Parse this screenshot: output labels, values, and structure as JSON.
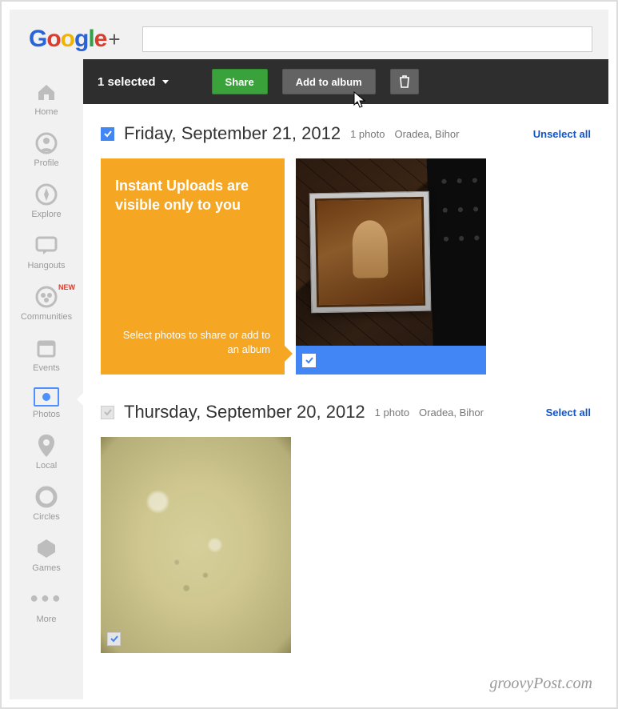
{
  "header": {
    "logo_text": "Google",
    "logo_plus": "+"
  },
  "nav": {
    "items": [
      {
        "label": "Home"
      },
      {
        "label": "Profile"
      },
      {
        "label": "Explore"
      },
      {
        "label": "Hangouts"
      },
      {
        "label": "Communities",
        "badge": "NEW"
      },
      {
        "label": "Events"
      },
      {
        "label": "Photos"
      },
      {
        "label": "Local"
      },
      {
        "label": "Circles"
      },
      {
        "label": "Games"
      },
      {
        "label": "More"
      }
    ]
  },
  "toolbar": {
    "selected_text": "1 selected",
    "share_label": "Share",
    "add_album_label": "Add to album"
  },
  "promo": {
    "title": "Instant Uploads are visible only to you",
    "subtitle": "Select photos to share or add to an album"
  },
  "groups": [
    {
      "checked": true,
      "title": "Friday, September 21, 2012",
      "count": "1 photo",
      "location": "Oradea, Bihor",
      "action": "Unselect all"
    },
    {
      "checked": false,
      "title": "Thursday, September 20, 2012",
      "count": "1 photo",
      "location": "Oradea, Bihor",
      "action": "Select all"
    }
  ],
  "watermark": "groovyPost.com"
}
